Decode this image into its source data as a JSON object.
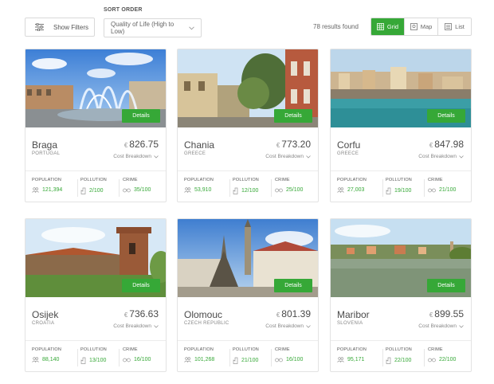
{
  "toolbar": {
    "filters_label": "Show Filters",
    "sort_heading": "SORT ORDER",
    "sort_value": "Quality of Life (High to Low)",
    "results_text": "78 results found",
    "views": [
      {
        "label": "Grid",
        "icon": "grid-icon",
        "active": true
      },
      {
        "label": "Map",
        "icon": "map-icon",
        "active": false
      },
      {
        "label": "List",
        "icon": "list-icon",
        "active": false
      }
    ]
  },
  "accent_color": "#36a837",
  "card_labels": {
    "details": "Details",
    "cost_breakdown": "Cost Breakdown",
    "population": "POPULATION",
    "pollution": "POLLUTION",
    "crime": "CRIME"
  },
  "cities": [
    {
      "name": "Braga",
      "country": "PORTUGAL",
      "currency": "€",
      "price": "826.75",
      "population": "121,394",
      "pollution": "2/100",
      "crime": "35/100"
    },
    {
      "name": "Chania",
      "country": "GREECE",
      "currency": "€",
      "price": "773.20",
      "population": "53,910",
      "pollution": "12/100",
      "crime": "25/100"
    },
    {
      "name": "Corfu",
      "country": "GREECE",
      "currency": "€",
      "price": "847.98",
      "population": "27,003",
      "pollution": "19/100",
      "crime": "21/100"
    },
    {
      "name": "Osijek",
      "country": "CROATIA",
      "currency": "€",
      "price": "736.63",
      "population": "88,140",
      "pollution": "13/100",
      "crime": "16/100"
    },
    {
      "name": "Olomouc",
      "country": "CZECH REPUBLIC",
      "currency": "€",
      "price": "801.39",
      "population": "101,268",
      "pollution": "21/100",
      "crime": "16/100"
    },
    {
      "name": "Maribor",
      "country": "SLOVENIA",
      "currency": "€",
      "price": "899.55",
      "population": "95,171",
      "pollution": "22/100",
      "crime": "22/100"
    }
  ]
}
